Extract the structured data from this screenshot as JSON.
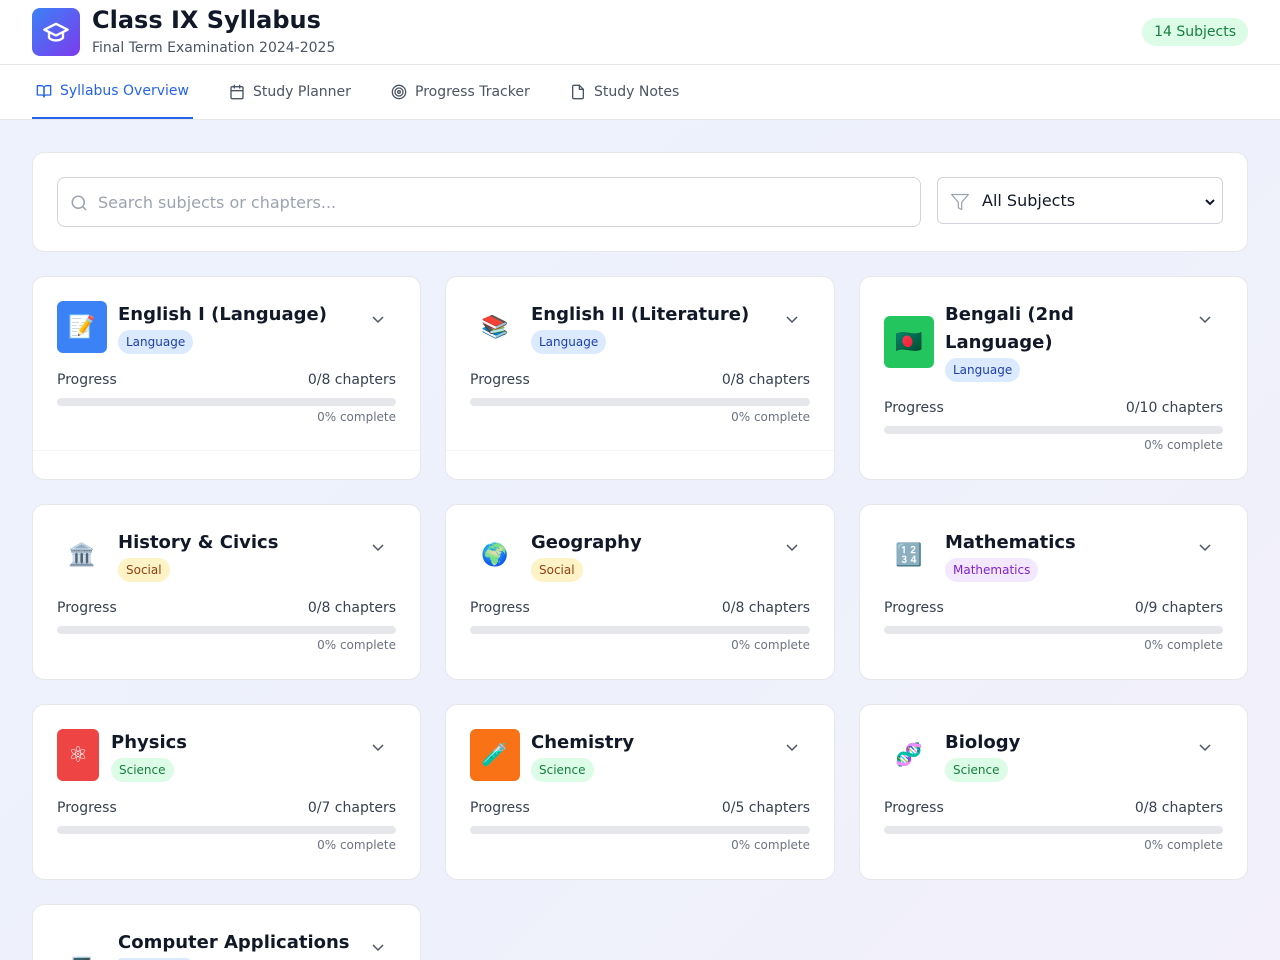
{
  "header": {
    "title": "Class IX Syllabus",
    "subtitle": "Final Term Examination 2024-2025",
    "subject_count": "14 Subjects"
  },
  "tabs": [
    {
      "label": "Syllabus Overview",
      "active": true
    },
    {
      "label": "Study Planner",
      "active": false
    },
    {
      "label": "Progress Tracker",
      "active": false
    },
    {
      "label": "Study Notes",
      "active": false
    }
  ],
  "search": {
    "placeholder": "Search subjects or chapters...",
    "value": ""
  },
  "filter": {
    "selected": "All Subjects"
  },
  "progress_label": "Progress",
  "subjects": [
    {
      "name": "English I (Language)",
      "category": "Language",
      "icon": "📝",
      "chapters": "0/8 chapters",
      "percent_text": "0% complete",
      "progress": 0
    },
    {
      "name": "English II (Literature)",
      "category": "Language",
      "icon": "📚",
      "chapters": "0/8 chapters",
      "percent_text": "0% complete",
      "progress": 0
    },
    {
      "name": "Bengali (2nd Language)",
      "category": "Language",
      "icon": "🇧🇩",
      "chapters": "0/10 chapters",
      "percent_text": "0% complete",
      "progress": 0
    },
    {
      "name": "History & Civics",
      "category": "Social",
      "icon": "🏛️",
      "chapters": "0/8 chapters",
      "percent_text": "0% complete",
      "progress": 0
    },
    {
      "name": "Geography",
      "category": "Social",
      "icon": "🌍",
      "chapters": "0/8 chapters",
      "percent_text": "0% complete",
      "progress": 0
    },
    {
      "name": "Mathematics",
      "category": "Mathematics",
      "icon": "🔢",
      "chapters": "0/9 chapters",
      "percent_text": "0% complete",
      "progress": 0
    },
    {
      "name": "Physics",
      "category": "Science",
      "icon": "⚛",
      "chapters": "0/7 chapters",
      "percent_text": "0% complete",
      "progress": 0
    },
    {
      "name": "Chemistry",
      "category": "Science",
      "icon": "🧪",
      "chapters": "0/5 chapters",
      "percent_text": "0% complete",
      "progress": 0
    },
    {
      "name": "Biology",
      "category": "Science",
      "icon": "🧬",
      "chapters": "0/8 chapters",
      "percent_text": "0% complete",
      "progress": 0
    },
    {
      "name": "Computer Applications",
      "category": "",
      "icon": "💻",
      "chapters": "",
      "percent_text": "",
      "progress": 0
    }
  ],
  "colors": {
    "accent": "#2563eb",
    "english1_icon_bg": "#3b82f6",
    "bengali_icon_bg": "#22c55e",
    "physics_icon_bg": "#ef4444",
    "chemistry_icon_bg": "#f97316"
  }
}
